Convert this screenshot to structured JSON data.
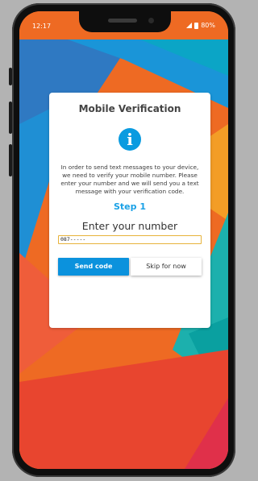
{
  "status_bar": {
    "time": "12:17",
    "battery": "80%"
  },
  "dialog": {
    "title": "Mobile Verification",
    "info_glyph": "i",
    "description": "In order to send text messages to your device, we need to verify your mobile number. Please enter your number and we will send you a text message with your verification code.",
    "step_label": "Step 1",
    "prompt": "Enter your number",
    "phone_input_value": "087-----",
    "send_code_label": "Send code",
    "skip_label": "Skip for now"
  },
  "colors": {
    "accent": "#0b92dd",
    "step_text": "#1aa1e6",
    "input_border": "#e7b23a"
  }
}
